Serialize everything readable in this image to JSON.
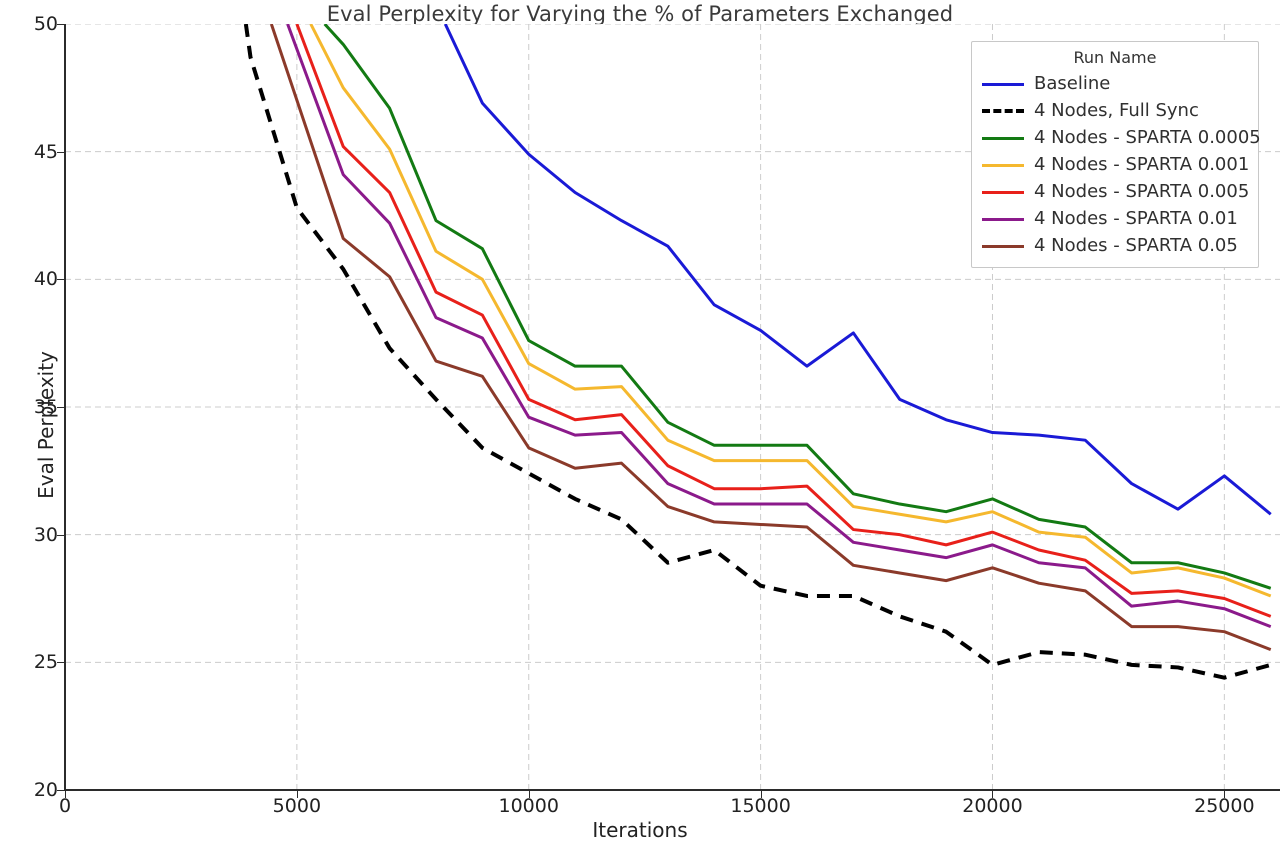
{
  "chart_data": {
    "type": "line",
    "title": "Eval Perplexity for Varying the % of Parameters Exchanged",
    "xlabel": "Iterations",
    "ylabel": "Eval Perplexity",
    "xlim": [
      0,
      26200
    ],
    "ylim": [
      20,
      50
    ],
    "xticks": [
      0,
      5000,
      10000,
      15000,
      20000,
      25000
    ],
    "xticklabels": [
      "0",
      "5000",
      "10000",
      "15000",
      "20000",
      "25000"
    ],
    "yticks": [
      20,
      25,
      30,
      35,
      40,
      45,
      50
    ],
    "yticklabels": [
      "20",
      "25",
      "30",
      "35",
      "40",
      "45",
      "50"
    ],
    "grid": true,
    "legend_title": "Run Name",
    "legend_position": "upper right",
    "series": [
      {
        "name": "Baseline",
        "color": "#1a1ad6",
        "style": "solid",
        "x": [
          8200,
          9000,
          10000,
          11000,
          12000,
          13000,
          14000,
          15000,
          16000,
          17000,
          18000,
          19000,
          20000,
          21000,
          22000,
          23000,
          24000,
          25000,
          26000
        ],
        "y": [
          50.0,
          46.9,
          44.9,
          43.4,
          42.3,
          41.3,
          39.0,
          38.0,
          36.6,
          37.9,
          35.3,
          34.5,
          34.0,
          33.9,
          33.7,
          32.0,
          31.0,
          32.3,
          30.8
        ]
      },
      {
        "name": "4 Nodes, Full Sync",
        "color": "#000000",
        "style": "dashed",
        "x": [
          3900,
          4000,
          5000,
          6000,
          7000,
          8000,
          9000,
          10000,
          11000,
          12000,
          13000,
          14000,
          15000,
          16000,
          17000,
          18000,
          19000,
          20000,
          21000,
          22000,
          23000,
          24000,
          25000,
          26000
        ],
        "y": [
          50.0,
          48.7,
          42.8,
          40.4,
          37.3,
          35.3,
          33.4,
          32.4,
          31.4,
          30.6,
          28.9,
          29.4,
          28.0,
          27.6,
          27.6,
          26.8,
          26.2,
          24.9,
          25.4,
          25.3,
          24.9,
          24.8,
          24.4,
          24.9
        ]
      },
      {
        "name": "4 Nodes - SPARTA 0.0005",
        "color": "#137a13",
        "style": "solid",
        "x": [
          5600,
          6000,
          7000,
          8000,
          9000,
          10000,
          11000,
          12000,
          13000,
          14000,
          15000,
          16000,
          17000,
          18000,
          19000,
          20000,
          21000,
          22000,
          23000,
          24000,
          25000,
          26000
        ],
        "y": [
          50.0,
          49.2,
          46.7,
          42.3,
          41.2,
          37.6,
          36.6,
          36.6,
          34.4,
          33.5,
          33.5,
          33.5,
          31.6,
          31.2,
          30.9,
          31.4,
          30.6,
          30.3,
          28.9,
          28.9,
          28.5,
          27.9
        ]
      },
      {
        "name": "4 Nodes - SPARTA 0.001",
        "color": "#f5b82e",
        "style": "solid",
        "x": [
          5300,
          6000,
          7000,
          8000,
          9000,
          10000,
          11000,
          12000,
          13000,
          14000,
          15000,
          16000,
          17000,
          18000,
          19000,
          20000,
          21000,
          22000,
          23000,
          24000,
          25000,
          26000
        ],
        "y": [
          50.0,
          47.5,
          45.1,
          41.1,
          40.0,
          36.7,
          35.7,
          35.8,
          33.7,
          32.9,
          32.9,
          32.9,
          31.1,
          30.8,
          30.5,
          30.9,
          30.1,
          29.9,
          28.5,
          28.7,
          28.3,
          27.6
        ]
      },
      {
        "name": "4 Nodes - SPARTA 0.005",
        "color": "#e8201a",
        "style": "solid",
        "x": [
          5000,
          6000,
          7000,
          8000,
          9000,
          10000,
          11000,
          12000,
          13000,
          14000,
          15000,
          16000,
          17000,
          18000,
          19000,
          20000,
          21000,
          22000,
          23000,
          24000,
          25000,
          26000
        ],
        "y": [
          50.0,
          45.2,
          43.4,
          39.5,
          38.6,
          35.3,
          34.5,
          34.7,
          32.7,
          31.8,
          31.8,
          31.9,
          30.2,
          30.0,
          29.6,
          30.1,
          29.4,
          29.0,
          27.7,
          27.8,
          27.5,
          26.8
        ]
      },
      {
        "name": "4 Nodes - SPARTA 0.01",
        "color": "#8b1a8b",
        "style": "solid",
        "x": [
          4800,
          6000,
          7000,
          8000,
          9000,
          10000,
          11000,
          12000,
          13000,
          14000,
          15000,
          16000,
          17000,
          18000,
          19000,
          20000,
          21000,
          22000,
          23000,
          24000,
          25000,
          26000
        ],
        "y": [
          50.0,
          44.1,
          42.2,
          38.5,
          37.7,
          34.6,
          33.9,
          34.0,
          32.0,
          31.2,
          31.2,
          31.2,
          29.7,
          29.4,
          29.1,
          29.6,
          28.9,
          28.7,
          27.2,
          27.4,
          27.1,
          26.4
        ]
      },
      {
        "name": "4 Nodes - SPARTA 0.05",
        "color": "#8b3a2a",
        "style": "solid",
        "x": [
          4450,
          6000,
          7000,
          8000,
          9000,
          10000,
          11000,
          12000,
          13000,
          14000,
          15000,
          16000,
          17000,
          18000,
          19000,
          20000,
          21000,
          22000,
          23000,
          24000,
          25000,
          26000
        ],
        "y": [
          50.0,
          41.6,
          40.1,
          36.8,
          36.2,
          33.4,
          32.6,
          32.8,
          31.1,
          30.5,
          30.4,
          30.3,
          28.8,
          28.5,
          28.2,
          28.7,
          28.1,
          27.8,
          26.4,
          26.4,
          26.2,
          25.5
        ]
      }
    ]
  },
  "legend": {
    "title": "Run Name",
    "items": [
      {
        "label": "Baseline"
      },
      {
        "label": "4 Nodes, Full Sync"
      },
      {
        "label": "4 Nodes - SPARTA 0.0005"
      },
      {
        "label": "4 Nodes - SPARTA 0.001"
      },
      {
        "label": "4 Nodes - SPARTA 0.005"
      },
      {
        "label": "4 Nodes - SPARTA 0.01"
      },
      {
        "label": "4 Nodes - SPARTA 0.05"
      }
    ]
  },
  "colors": {
    "grid": "#cccccc",
    "axis": "#2b2b2b",
    "title_text": "#3a3a3a",
    "tick_text": "#222222",
    "legend_border": "#c8c8c8",
    "background": "#ffffff"
  }
}
